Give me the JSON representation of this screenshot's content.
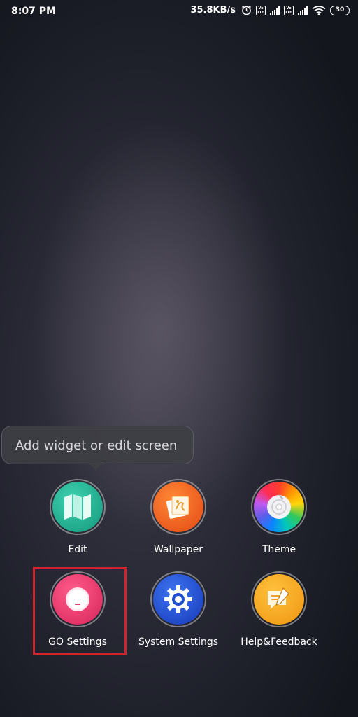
{
  "status_bar": {
    "time": "8:07 PM",
    "network_speed": "35.8KB/s",
    "icons": [
      "alarm-icon",
      "volte-icon",
      "signal-icon",
      "volte-icon",
      "signal-icon",
      "wifi-icon"
    ],
    "volte_label": "Vo LTE",
    "battery_level": "30"
  },
  "tooltip": {
    "text": "Add widget or edit screen"
  },
  "menu": {
    "items": [
      {
        "label": "Edit",
        "icon": "map-icon",
        "color": "#1fae8f"
      },
      {
        "label": "Wallpaper",
        "icon": "wallpaper-icon",
        "color": "#f0561f"
      },
      {
        "label": "Theme",
        "icon": "theme-icon",
        "color": "#c43dc9"
      },
      {
        "label": "GO Settings",
        "icon": "go-settings-icon",
        "color": "#e4346a"
      },
      {
        "label": "System Settings",
        "icon": "gear-icon",
        "color": "#1e4fcf"
      },
      {
        "label": "Help&Feedback",
        "icon": "help-feedback-icon",
        "color": "#f5a81c"
      }
    ]
  },
  "highlight_color": "#d2232a"
}
